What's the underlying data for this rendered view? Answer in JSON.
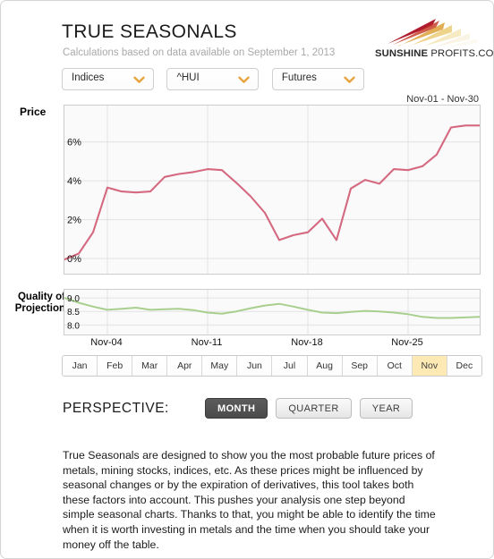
{
  "header": {
    "title": "TRUE SEASONALS",
    "subtitle": "Calculations based on data available on September 1, 2013",
    "logo_bold": "SUNSHINE",
    "logo_rest": " PROFITS.COM"
  },
  "filters": [
    {
      "name": "asset-class",
      "value": "Indices"
    },
    {
      "name": "symbol",
      "value": "^HUI"
    },
    {
      "name": "market-type",
      "value": "Futures"
    }
  ],
  "range_label": "Nov-01 - Nov-30",
  "labels": {
    "price": "Price",
    "quality_line1": "Quality of",
    "quality_line2": "Projection"
  },
  "months": {
    "items": [
      "Jan",
      "Feb",
      "Mar",
      "Apr",
      "May",
      "Jun",
      "Jul",
      "Aug",
      "Sep",
      "Oct",
      "Nov",
      "Dec"
    ],
    "active": "Nov"
  },
  "perspective": {
    "label": "PERSPECTIVE:",
    "options": [
      "MONTH",
      "QUARTER",
      "YEAR"
    ],
    "active": "MONTH"
  },
  "description": "True Seasonals are designed to show you the most probable future prices of metals, mining stocks, indices, etc. As these prices might be influenced by seasonal changes or by the expiration of derivatives, this tool takes both these factors into account. This pushes your analysis one step beyond simple seasonal charts. Thanks to that, you might be able to identify the time when it is worth investing in metals and the time when you should take your money off the table.",
  "colors": {
    "price_line": "#d4697f",
    "quality_line": "#a8cf8e",
    "accent": "#e8a33d",
    "month_active": "#fde9b4",
    "chart_bg": "#fafafa",
    "grid": "#e2e2e2"
  },
  "chart_data": [
    {
      "type": "line",
      "name": "price-seasonal",
      "title": "Price",
      "xlabel": "",
      "ylabel": "Price",
      "ylim": [
        -0.6,
        7.6
      ],
      "ytick_labels": [
        "0%",
        "2%",
        "4%",
        "6%"
      ],
      "ytick_values": [
        0,
        2,
        4,
        6
      ],
      "xtick_labels": [
        "Nov-04",
        "Nov-11",
        "Nov-18",
        "Nov-25"
      ],
      "xtick_positions": [
        4,
        11,
        18,
        25
      ],
      "grid": true,
      "legend": "none",
      "line_color": "#d4697f",
      "x": [
        1,
        2,
        3,
        4,
        5,
        6,
        7,
        8,
        9,
        10,
        11,
        12,
        13,
        14,
        15,
        16,
        17,
        18,
        19,
        20,
        21,
        22,
        23,
        24,
        25,
        26,
        27,
        28,
        29,
        30
      ],
      "values": [
        -0.05,
        0.25,
        1.35,
        3.65,
        3.45,
        3.4,
        3.45,
        4.2,
        4.35,
        4.45,
        4.6,
        4.55,
        3.9,
        3.2,
        2.35,
        0.95,
        1.2,
        1.35,
        2.05,
        0.95,
        3.6,
        4.05,
        3.85,
        4.6,
        4.55,
        4.75,
        5.35,
        6.75,
        6.85,
        6.85
      ]
    },
    {
      "type": "line",
      "name": "quality-of-projection",
      "title": "Quality of Projection",
      "xlabel": "",
      "ylabel": "Quality of Projection",
      "ylim": [
        7.75,
        9.2
      ],
      "ytick_labels": [
        "8.0",
        "8.5",
        "9.0"
      ],
      "ytick_values": [
        8.0,
        8.5,
        9.0
      ],
      "xtick_labels": [
        "Nov-04",
        "Nov-11",
        "Nov-18",
        "Nov-25"
      ],
      "grid": true,
      "legend": "none",
      "line_color": "#a8cf8e",
      "x": [
        1,
        2,
        3,
        4,
        5,
        6,
        7,
        8,
        9,
        10,
        11,
        12,
        13,
        14,
        15,
        16,
        17,
        18,
        19,
        20,
        21,
        22,
        23,
        24,
        25,
        26,
        27,
        28,
        29,
        30
      ],
      "values": [
        9.0,
        8.82,
        8.68,
        8.56,
        8.6,
        8.64,
        8.56,
        8.58,
        8.6,
        8.55,
        8.46,
        8.42,
        8.5,
        8.62,
        8.72,
        8.78,
        8.68,
        8.56,
        8.46,
        8.44,
        8.48,
        8.52,
        8.5,
        8.46,
        8.4,
        8.3,
        8.26,
        8.26,
        8.28,
        8.3
      ]
    }
  ]
}
